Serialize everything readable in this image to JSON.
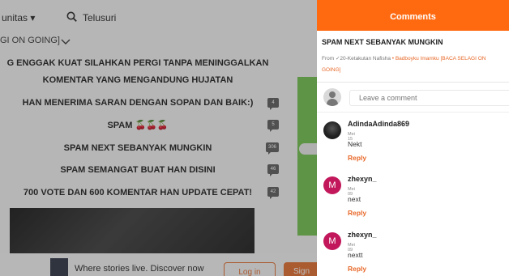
{
  "nav": {
    "community_label": "unitas ▾",
    "search_label": "Telusuri",
    "story_subtitle": "GI ON GOING]"
  },
  "parts": {
    "cut_line_1": "G ENGGAK KUAT SILAHKAN PERGI TANPA MENINGGALKAN",
    "cut_line_2": "KOMENTAR YANG MENGANDUNG HUJATAN",
    "rows": [
      {
        "title": "HAN MENERIMA SARAN DENGAN SOPAN DAN BAIK:)",
        "count": "4"
      },
      {
        "title": "SPAM 🍒🍒🍒",
        "count": "5"
      },
      {
        "title": "SPAM NEXT SEBANYAK MUNGKIN",
        "count": "306"
      },
      {
        "title": "SPAM SEMANGAT BUAT HAN DISINI",
        "count": "46"
      },
      {
        "title": "700 VOTE DAN 600 KOMENTAR HAN UPDATE CEPAT!",
        "count": "42"
      }
    ]
  },
  "bottom_bar": {
    "tagline": "Where stories live. Discover now",
    "login_label": "Log in",
    "signup_label": "Sign"
  },
  "comments_panel": {
    "header": "Comments",
    "part_title": "SPAM NEXT SEBANYAK MUNGKIN",
    "from_prefix": "From ✓20-Ketakutan Nafisha",
    "dot": "•",
    "story_link": "Badboyku Imamku [BACA SELAGI ON",
    "story_link_cont": "GOING]",
    "compose_placeholder": "Leave a comment",
    "comments": [
      {
        "username": "AdindaAdinda869",
        "date": "Mei 15",
        "text": "Nekt",
        "reply_label": "Reply",
        "avatar_letter": ""
      },
      {
        "username": "zhexyn_",
        "date": "Mei 09",
        "text": "next",
        "reply_label": "Reply",
        "avatar_letter": "M"
      },
      {
        "username": "zhexyn_",
        "date": "Mei 09",
        "text": "nextt",
        "reply_label": "Reply",
        "avatar_letter": "M"
      }
    ]
  },
  "colors": {
    "accent": "#ff6a10",
    "link": "#e8692a",
    "avatar_letter_bg": "#c2185b"
  }
}
